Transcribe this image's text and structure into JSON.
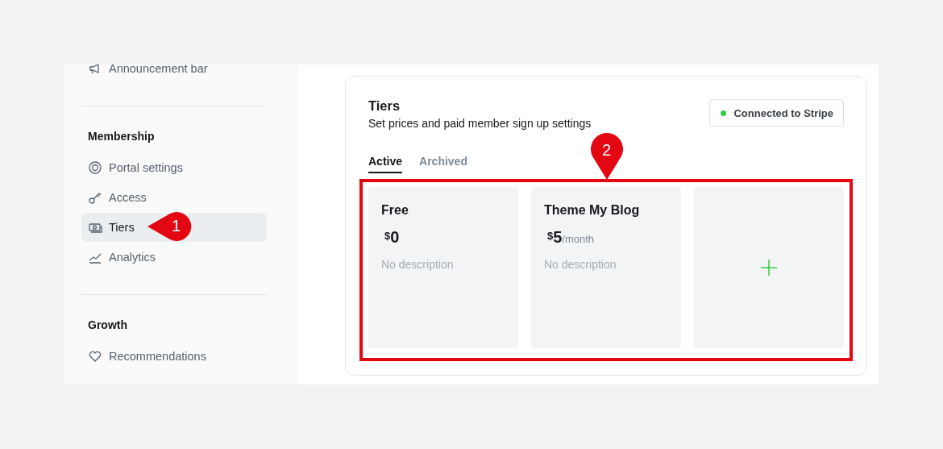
{
  "sidebar": {
    "sections": [
      {
        "items": [
          {
            "label": "Announcement bar",
            "selected": false
          }
        ]
      },
      {
        "heading": "Membership",
        "items": [
          {
            "label": "Portal settings",
            "selected": false
          },
          {
            "label": "Access",
            "selected": false
          },
          {
            "label": "Tiers",
            "selected": true
          },
          {
            "label": "Analytics",
            "selected": false
          }
        ]
      },
      {
        "heading": "Growth",
        "items": [
          {
            "label": "Recommendations",
            "selected": false
          }
        ]
      }
    ]
  },
  "panel": {
    "title": "Tiers",
    "subtitle": "Set prices and paid member sign up settings",
    "stripe_button": {
      "label": "Connected to Stripe"
    },
    "tabs": [
      {
        "label": "Active",
        "selected": true
      },
      {
        "label": "Archived",
        "selected": false
      }
    ],
    "tiers": [
      {
        "kind": "tier",
        "name": "Free",
        "currency": "$",
        "amount": "0",
        "description": "No description"
      },
      {
        "kind": "tier",
        "name": "Theme My Blog",
        "currency": "$",
        "amount": "5",
        "period": "/month",
        "description": "No description"
      },
      {
        "kind": "add"
      }
    ]
  },
  "annotations": [
    {
      "kind": "callout-left",
      "label": "1"
    },
    {
      "kind": "callout-down",
      "label": "2"
    },
    {
      "kind": "highlight-box"
    }
  ]
}
